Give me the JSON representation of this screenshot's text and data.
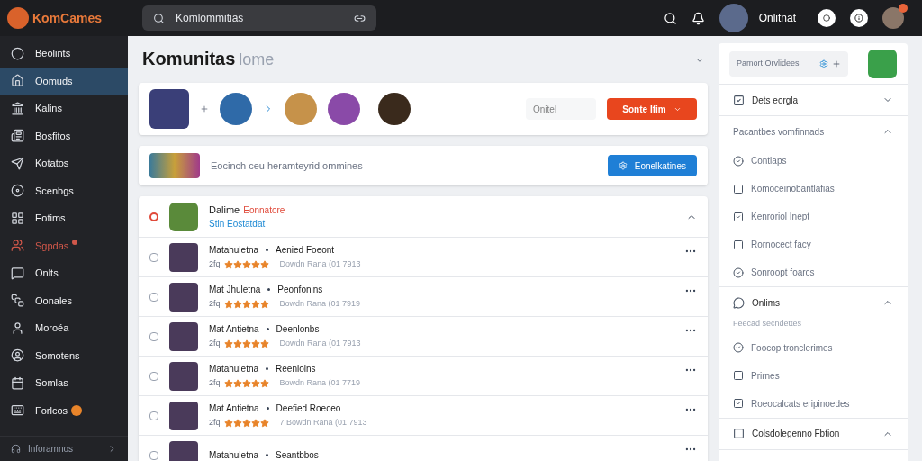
{
  "header": {
    "logo": "KomCames",
    "search": "Komlommitias",
    "user_name": "Onlitnat",
    "notifications": true
  },
  "sidebar": {
    "items": [
      {
        "label": "Beolints",
        "selected": false,
        "highlighted": false,
        "badge": false
      },
      {
        "label": "Oomuds",
        "selected": true,
        "highlighted": false,
        "badge": false
      },
      {
        "label": "Kalins",
        "selected": false,
        "highlighted": false,
        "badge": false
      },
      {
        "label": "Bosfitos",
        "selected": false,
        "highlighted": false,
        "badge": false
      },
      {
        "label": "Kotatos",
        "selected": false,
        "highlighted": false,
        "badge": false
      },
      {
        "label": "Scenbgs",
        "selected": false,
        "highlighted": false,
        "badge": false
      },
      {
        "label": "Eotims",
        "selected": false,
        "highlighted": false,
        "badge": false
      },
      {
        "label": "Sgpdas",
        "selected": false,
        "highlighted": true,
        "badge": false
      },
      {
        "label": "Onlts",
        "selected": false,
        "highlighted": false,
        "badge": false
      },
      {
        "label": "Oonales",
        "selected": false,
        "highlighted": false,
        "badge": false
      },
      {
        "label": "Moroéa",
        "selected": false,
        "highlighted": false,
        "badge": false
      },
      {
        "label": "Somotens",
        "selected": false,
        "highlighted": false,
        "badge": false
      },
      {
        "label": "Somlas",
        "selected": false,
        "highlighted": false,
        "badge": false
      },
      {
        "label": "Forlcos",
        "selected": false,
        "highlighted": false,
        "badge": true
      }
    ],
    "footer": "Inforamnos"
  },
  "page": {
    "title": "Komunitas",
    "subtitle": "lome"
  },
  "members_card": {
    "field_placeholder": "Onitel",
    "button": "Sonte Ifim"
  },
  "banner": {
    "text": "Eocinch ceu heramteyrid ommines",
    "button": "Eonelkatines"
  },
  "list": {
    "title": "Dalime",
    "tag": "Eonnatore",
    "subtitle": "Stin Eostatdat",
    "expanded": true,
    "rows": [
      {
        "title": "Matahuletna",
        "tag": "Aenied Foeont",
        "prefix": "2fq",
        "stars": 5,
        "meta": "Dowdn Rana (01 7913",
        "checked": false
      },
      {
        "title": "Mat Jhuletna",
        "tag": "Peonfonins",
        "prefix": "2fq",
        "stars": 5,
        "meta": "Bowdn Rana (01 7919",
        "checked": false
      },
      {
        "title": "Mat Antietna",
        "tag": "Deenlonbs",
        "prefix": "2fq",
        "stars": 5,
        "meta": "Dowdn Rana (01 7913",
        "checked": false
      },
      {
        "title": "Matahuletna",
        "tag": "Reenloins",
        "prefix": "2fq",
        "stars": 5,
        "meta": "Bowdn Rana (01 7719",
        "checked": false
      },
      {
        "title": "Mat Antietna",
        "tag": "Deefied Roeceo",
        "prefix": "2fq",
        "stars": 5,
        "meta": "7 Bowdn Rana (01 7913",
        "checked": false
      },
      {
        "title": "Matahuletna",
        "tag": "Seantbbos",
        "checked": false
      }
    ]
  },
  "right_panel": {
    "field": "Pamort Orvlidees",
    "sections": [
      {
        "title": "Dets eorgla",
        "kind": "check",
        "expanded": false
      },
      {
        "title": "Pacantbes vomfinnads",
        "kind": "plain",
        "expanded": true,
        "items": [
          "Contiaps",
          "Komoceinobantlafias",
          "Kenroriol Inept",
          "Rornocect facy",
          "Sonroopt foarcs"
        ]
      },
      {
        "title": "Onlims",
        "kind": "icon",
        "subtitle": "Feecad secndettes",
        "expanded": true,
        "items": [
          "Foocop tronclerimes",
          "Prirnes",
          "Roeocalcats eripinoedes"
        ]
      },
      {
        "title": "Colsdolegenno Fbtion",
        "kind": "check",
        "expanded": true
      }
    ]
  }
}
